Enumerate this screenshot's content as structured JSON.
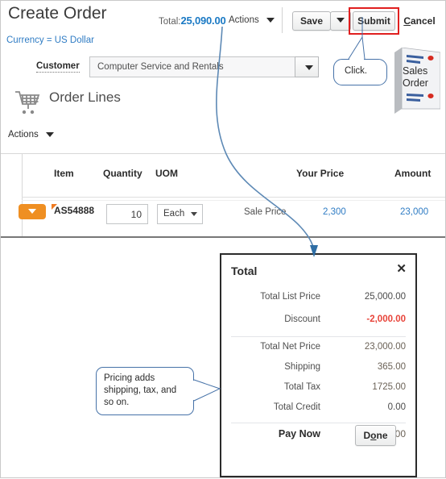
{
  "header": {
    "page_title": "Create Order",
    "total_label": "Total:",
    "total_value": "25,090.00",
    "actions_label": "Actions",
    "save_label": "Save",
    "submit_label": "Submit",
    "cancel_label": "Cancel",
    "cancel_accesskey": "C",
    "currency_text": "Currency = US Dollar"
  },
  "customer": {
    "label": "Customer",
    "value": "Computer Service and Rentals"
  },
  "order_lines": {
    "section_title": "Order Lines",
    "actions_label": "Actions",
    "columns": [
      "Item",
      "Quantity",
      "UOM",
      "Your Price",
      "Amount"
    ],
    "rows": [
      {
        "item": "AS54888",
        "quantity": "10",
        "uom": "Each",
        "price_type": "Sale Price",
        "your_price": "2,300",
        "amount": "23,000"
      }
    ]
  },
  "total_panel": {
    "title": "Total",
    "close_icon": "✕",
    "lines": [
      {
        "label": "Total List Price",
        "value": "25,000.00",
        "style": "grey"
      },
      {
        "label": "Discount",
        "value": "-2,000.00",
        "style": "red"
      },
      {
        "label": "Total Net Price",
        "value": "23,000.00",
        "style": "tan"
      },
      {
        "label": "Shipping",
        "value": "365.00",
        "style": "tan"
      },
      {
        "label": "Total Tax",
        "value": "1725.00",
        "style": "tan"
      },
      {
        "label": "Total Credit",
        "value": "0.00",
        "style": "grey"
      },
      {
        "label": "Pay Now",
        "value": "25,090.00",
        "style": "tan"
      }
    ],
    "done_label": "Done",
    "done_accesskey": "o"
  },
  "callouts": {
    "click": "Click.",
    "pricing_line1": "Pricing adds",
    "pricing_line2": "shipping, tax, and",
    "pricing_line3": "so on."
  },
  "sales_order_graphic": {
    "line1": "Sales",
    "line2": "Order"
  },
  "colors": {
    "link_blue": "#2f7cc4",
    "total_blue": "#1a79c4",
    "accent_orange": "#ef8f22",
    "discount_red": "#e8443a",
    "highlight_red": "#e01f1f",
    "callout_border": "#4672a8"
  }
}
